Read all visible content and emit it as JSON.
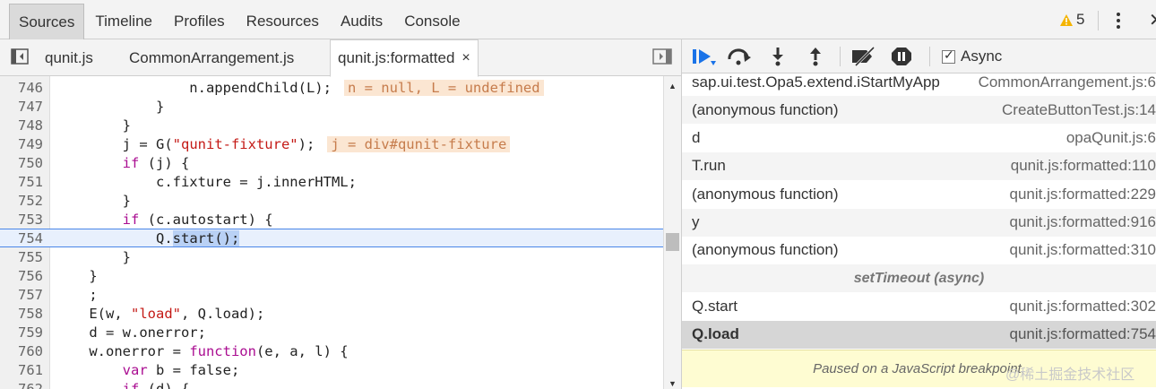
{
  "top_tabs": [
    "Sources",
    "Timeline",
    "Profiles",
    "Resources",
    "Audits",
    "Console"
  ],
  "warnings_count": "5",
  "file_tabs": {
    "items": [
      "qunit.js",
      "CommonArrangement.js",
      "qunit.js:formatted"
    ],
    "active": "qunit.js:formatted",
    "close": "×"
  },
  "code_lines": [
    {
      "n": "746",
      "t": "                n.appendChild(L);",
      "inline": "n = null, L = undefined"
    },
    {
      "n": "747",
      "t": "            }"
    },
    {
      "n": "748",
      "t": "        }"
    },
    {
      "n": "749",
      "t": "        j = G(\"qunit-fixture\");",
      "inline": "j = div#qunit-fixture"
    },
    {
      "n": "750",
      "t": "        if (j) {"
    },
    {
      "n": "751",
      "t": "            c.fixture = j.innerHTML;"
    },
    {
      "n": "752",
      "t": "        }"
    },
    {
      "n": "753",
      "t": "        if (c.autostart) {"
    },
    {
      "n": "754",
      "t": "            Q.start();",
      "current": true
    },
    {
      "n": "755",
      "t": "        }"
    },
    {
      "n": "756",
      "t": "    }"
    },
    {
      "n": "757",
      "t": "    ;"
    },
    {
      "n": "758",
      "t": "    E(w, \"load\", Q.load);"
    },
    {
      "n": "759",
      "t": "    d = w.onerror;"
    },
    {
      "n": "760",
      "t": "    w.onerror = function(e, a, l) {"
    },
    {
      "n": "761",
      "t": "        var b = false;"
    },
    {
      "n": "762",
      "t": "        if (d) {"
    }
  ],
  "debugger": {
    "async_label": "Async",
    "async_checked": true,
    "call_stack": [
      {
        "fn": "sap.ui.test.Opa5.extend.iStartMyApp",
        "loc": "CommonArrangement.js:6"
      },
      {
        "fn": "(anonymous function)",
        "loc": "CreateButtonTest.js:14"
      },
      {
        "fn": "d",
        "loc": "opaQunit.js:6"
      },
      {
        "fn": "T.run",
        "loc": "qunit.js:formatted:110"
      },
      {
        "fn": "(anonymous function)",
        "loc": "qunit.js:formatted:229"
      },
      {
        "fn": "y",
        "loc": "qunit.js:formatted:916"
      },
      {
        "fn": "(anonymous function)",
        "loc": "qunit.js:formatted:310"
      },
      {
        "async": "setTimeout (async)"
      },
      {
        "fn": "Q.start",
        "loc": "qunit.js:formatted:302"
      },
      {
        "fn": "Q.load",
        "loc": "qunit.js:formatted:754",
        "selected": true
      }
    ],
    "paused_message": "Paused on a JavaScript breakpoint."
  },
  "watermark": "@稀土掘金技术社区",
  "colors": {
    "accent": "#1a73e8",
    "warning": "#f4b400",
    "selected_line": "#e8f0fd"
  }
}
